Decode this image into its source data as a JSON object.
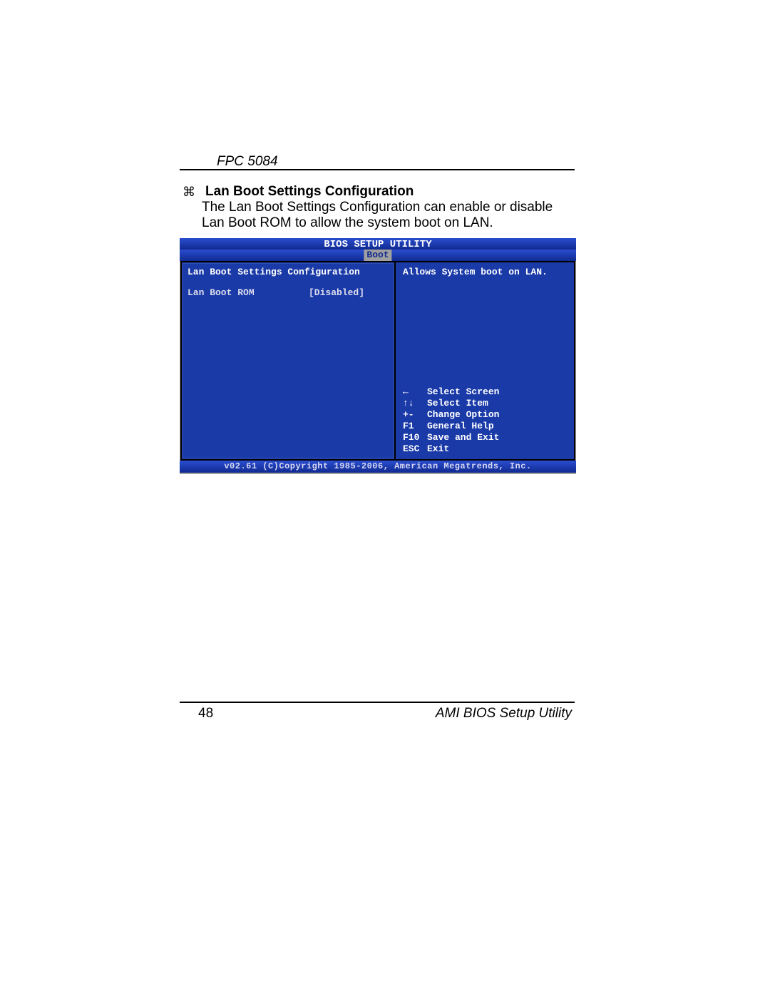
{
  "header": {
    "doc_title": "FPC 5084"
  },
  "section": {
    "bullet_glyph": "⌘",
    "title": "Lan Boot Settings Configuration",
    "desc": "The Lan Boot Settings Configuration can enable or disable Lan Boot ROM to allow the system boot on LAN."
  },
  "bios": {
    "title": "BIOS SETUP UTILITY",
    "tab": "Boot",
    "left_title": "Lan Boot Settings Configuration",
    "setting_label": "Lan Boot ROM",
    "setting_value": "[Disabled]",
    "help_text": "Allows System boot on LAN.",
    "keys": [
      {
        "key": "←",
        "action": "Select Screen"
      },
      {
        "key": "↑↓",
        "action": "Select Item"
      },
      {
        "key": "+-",
        "action": "Change Option"
      },
      {
        "key": "F1",
        "action": "General Help"
      },
      {
        "key": "F10",
        "action": "Save and Exit"
      },
      {
        "key": "ESC",
        "action": "Exit"
      }
    ],
    "footer": "v02.61 (C)Copyright 1985-2006, American Megatrends, Inc."
  },
  "footer": {
    "page_number": "48",
    "footer_text": "AMI BIOS Setup Utility"
  }
}
